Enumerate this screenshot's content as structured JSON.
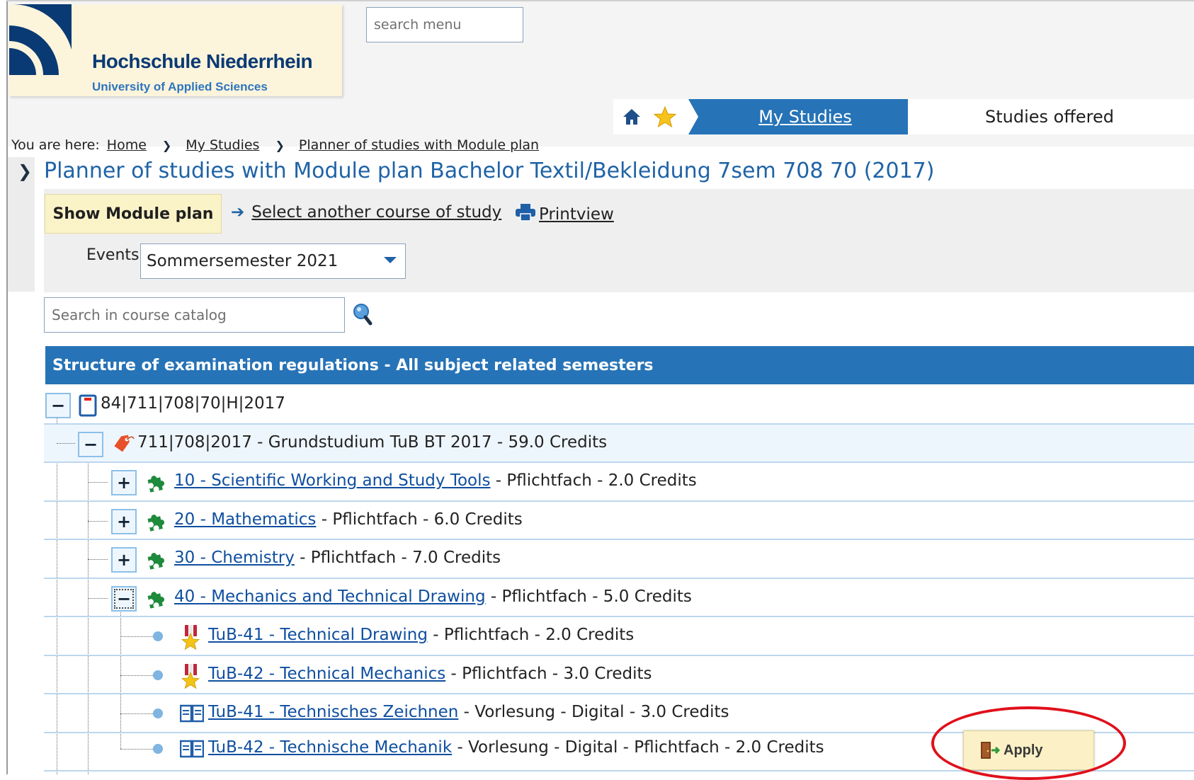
{
  "header": {
    "logo_title": "Hochschule Niederrhein",
    "logo_subtitle": "University of Applied Sciences",
    "menu_search_placeholder": "search menu"
  },
  "nav": {
    "home_icon": "home-icon",
    "favorites_icon": "star-icon",
    "tabs": [
      {
        "label": "My Studies",
        "active": true
      },
      {
        "label": "Studies offered",
        "active": false
      }
    ],
    "active_color": "#2673b7"
  },
  "breadcrumb": {
    "prefix": "You are here:",
    "items": [
      "Home",
      "My Studies",
      "Planner of studies with Module plan"
    ]
  },
  "page": {
    "title": "Planner of studies with Module plan Bachelor Textil/Bekleidung 7sem 708 70 (2017)"
  },
  "toolbar": {
    "show_module_plan": "Show Module plan",
    "select_course": "Select another course of study",
    "printview": "Printview",
    "events_label": "Events",
    "events_value": "Sommersemester 2021",
    "catalog_search_placeholder": "Search in course catalog"
  },
  "structure": {
    "header": "Structure of examination regulations - All subject related semesters",
    "root": {
      "label": "84|711|708|70|H|2017",
      "expanded": true
    },
    "group": {
      "label": "711|708|2017 - Grundstudium TuB BT 2017 - 59.0 Credits",
      "expanded": true
    },
    "modules": [
      {
        "link": "10 - Scientific Working and Study Tools",
        "rest": " - Pflichtfach - 2.0 Credits",
        "expanded": false
      },
      {
        "link": "20 - Mathematics",
        "rest": " - Pflichtfach - 6.0 Credits",
        "expanded": false
      },
      {
        "link": "30 - Chemistry",
        "rest": " - Pflichtfach - 7.0 Credits",
        "expanded": false
      },
      {
        "link": "40 - Mechanics and Technical Drawing",
        "rest": " - Pflichtfach - 5.0 Credits",
        "expanded": true
      }
    ],
    "items": [
      {
        "icon": "award-icon",
        "link": "TuB-41 - Technical Drawing",
        "rest": " - Pflichtfach - 2.0 Credits"
      },
      {
        "icon": "award-icon",
        "link": "TuB-42 - Technical Mechanics",
        "rest": " - Pflichtfach - 3.0 Credits"
      },
      {
        "icon": "book-icon",
        "link": "TuB-41 - Technisches Zeichnen",
        "rest": " - Vorlesung - Digital - 3.0 Credits"
      },
      {
        "icon": "book-icon",
        "link": "TuB-42 - Technische Mechanik",
        "rest": " - Vorlesung - Digital - Pflichtfach - 2.0 Credits"
      }
    ]
  },
  "apply_button": {
    "label": "Apply",
    "icon": "door-enter-icon"
  },
  "annotation": {
    "color": "#e0101a"
  }
}
